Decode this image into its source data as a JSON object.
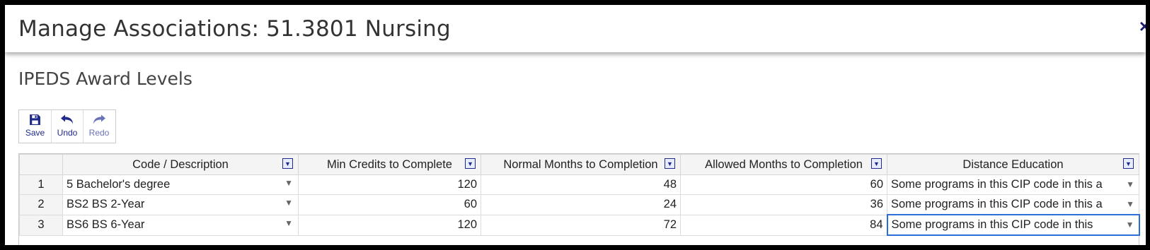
{
  "dialog": {
    "title": "Manage Associations: 51.3801 Nursing",
    "close_label": "×"
  },
  "section": {
    "title": "IPEDS Award Levels"
  },
  "toolbar": {
    "save_label": "Save",
    "undo_label": "Undo",
    "redo_label": "Redo"
  },
  "grid": {
    "columns": [
      "",
      "Code / Description",
      "Min Credits to Complete",
      "Normal Months to Completion",
      "Allowed Months to Completion",
      "Distance Education"
    ],
    "rows": [
      {
        "num": "1",
        "code": "5 Bachelor's degree",
        "min_credits": "120",
        "normal_months": "48",
        "allowed_months": "60",
        "distance": "Some programs in this CIP code in this a"
      },
      {
        "num": "2",
        "code": "BS2 BS 2-Year",
        "min_credits": "60",
        "normal_months": "24",
        "allowed_months": "36",
        "distance": "Some programs in this CIP code in this a"
      },
      {
        "num": "3",
        "code": "BS6 BS 6-Year",
        "min_credits": "120",
        "normal_months": "72",
        "allowed_months": "84",
        "distance": "Some programs in this CIP code in this"
      }
    ]
  },
  "icons": {
    "save": "floppy-disk-icon",
    "undo": "undo-arrow-icon",
    "redo": "redo-arrow-icon",
    "filter": "filter-dropdown-icon",
    "dropdown": "dropdown-triangle-icon"
  }
}
